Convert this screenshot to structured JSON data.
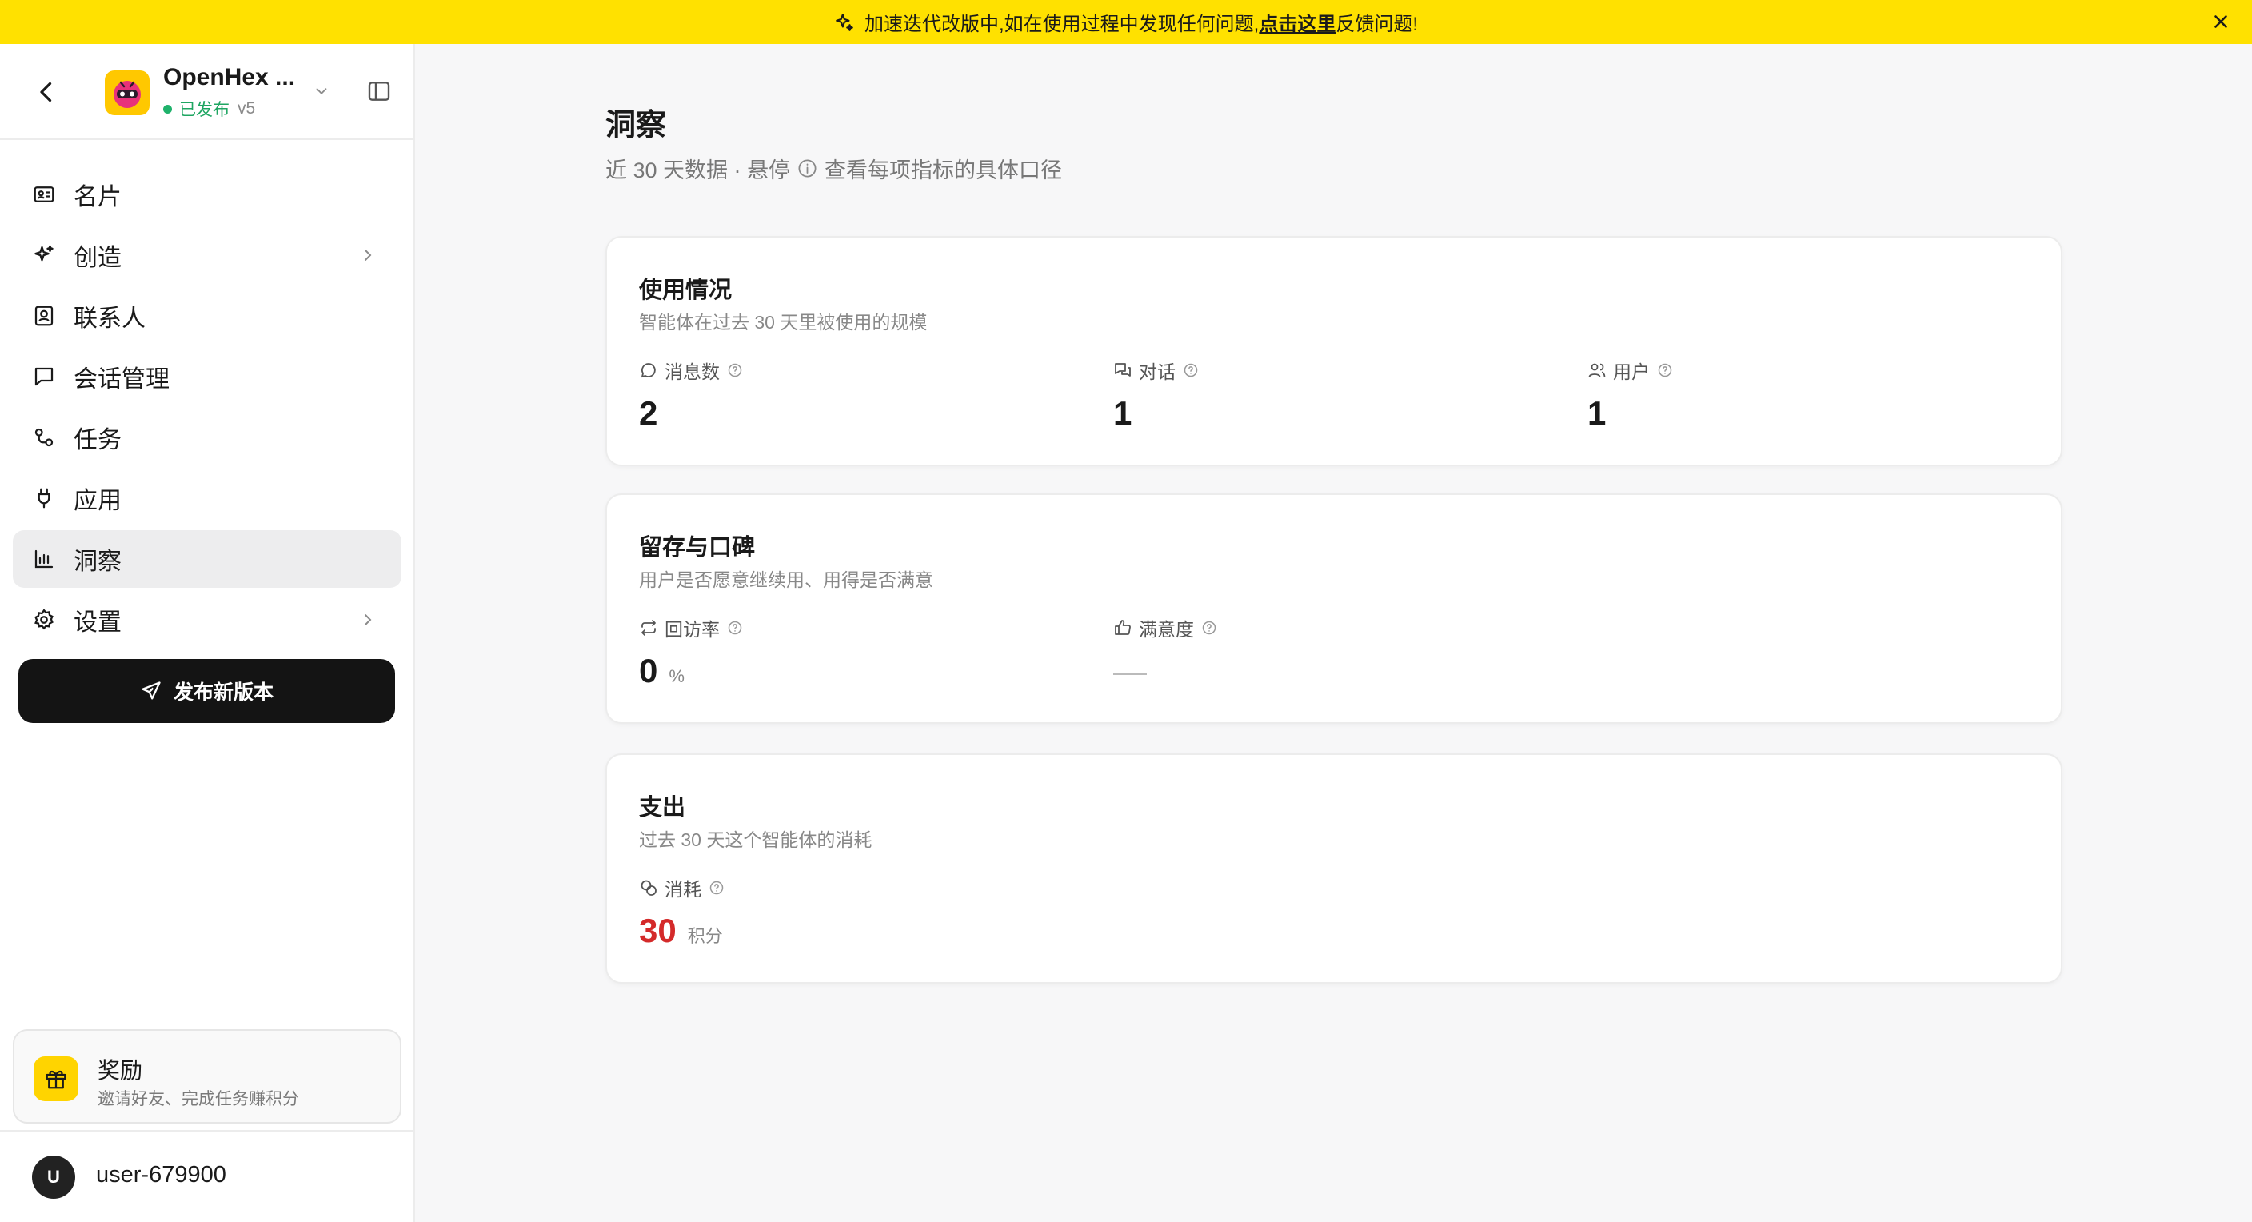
{
  "banner": {
    "text_before": "加速迭代改版中,如在使用过程中发现任何问题,",
    "link": "点击这里",
    "text_after": "反馈问题!"
  },
  "app": {
    "name": "OpenHex ...",
    "status": "已发布",
    "version": "v5"
  },
  "nav": [
    {
      "label": "名片",
      "icon": "id-card-icon"
    },
    {
      "label": "创造",
      "icon": "sparkles-icon",
      "chevron": true
    },
    {
      "label": "联系人",
      "icon": "contact-icon"
    },
    {
      "label": "会话管理",
      "icon": "chat-icon"
    },
    {
      "label": "任务",
      "icon": "task-icon"
    },
    {
      "label": "应用",
      "icon": "plug-icon"
    },
    {
      "label": "洞察",
      "icon": "chart-icon",
      "active": true
    },
    {
      "label": "设置",
      "icon": "gear-icon",
      "chevron": true
    }
  ],
  "publish_button": "发布新版本",
  "reward": {
    "title": "奖励",
    "desc": "邀请好友、完成任务赚积分"
  },
  "user": {
    "initial": "U",
    "name": "user-679900"
  },
  "page": {
    "title": "洞察",
    "subtitle_before": "近 30 天数据 · 悬停",
    "subtitle_after": "查看每项指标的具体口径"
  },
  "cards": {
    "usage": {
      "title": "使用情况",
      "desc": "智能体在过去 30 天里被使用的规模",
      "messages": {
        "label": "消息数",
        "value": "2"
      },
      "conversations": {
        "label": "对话",
        "value": "1"
      },
      "users": {
        "label": "用户",
        "value": "1"
      }
    },
    "retention": {
      "title": "留存与口碑",
      "desc": "用户是否愿意继续用、用得是否满意",
      "revisit": {
        "label": "回访率",
        "value": "0",
        "unit": "%"
      },
      "satisfaction": {
        "label": "满意度",
        "value": "—"
      }
    },
    "spend": {
      "title": "支出",
      "desc": "过去 30 天这个智能体的消耗",
      "consumption": {
        "label": "消耗",
        "value": "30",
        "unit": "积分"
      }
    }
  },
  "colors": {
    "banner": "#ffe100",
    "accent_red": "#d42a2a",
    "published_green": "#1fa662",
    "primary_button": "#141414"
  }
}
